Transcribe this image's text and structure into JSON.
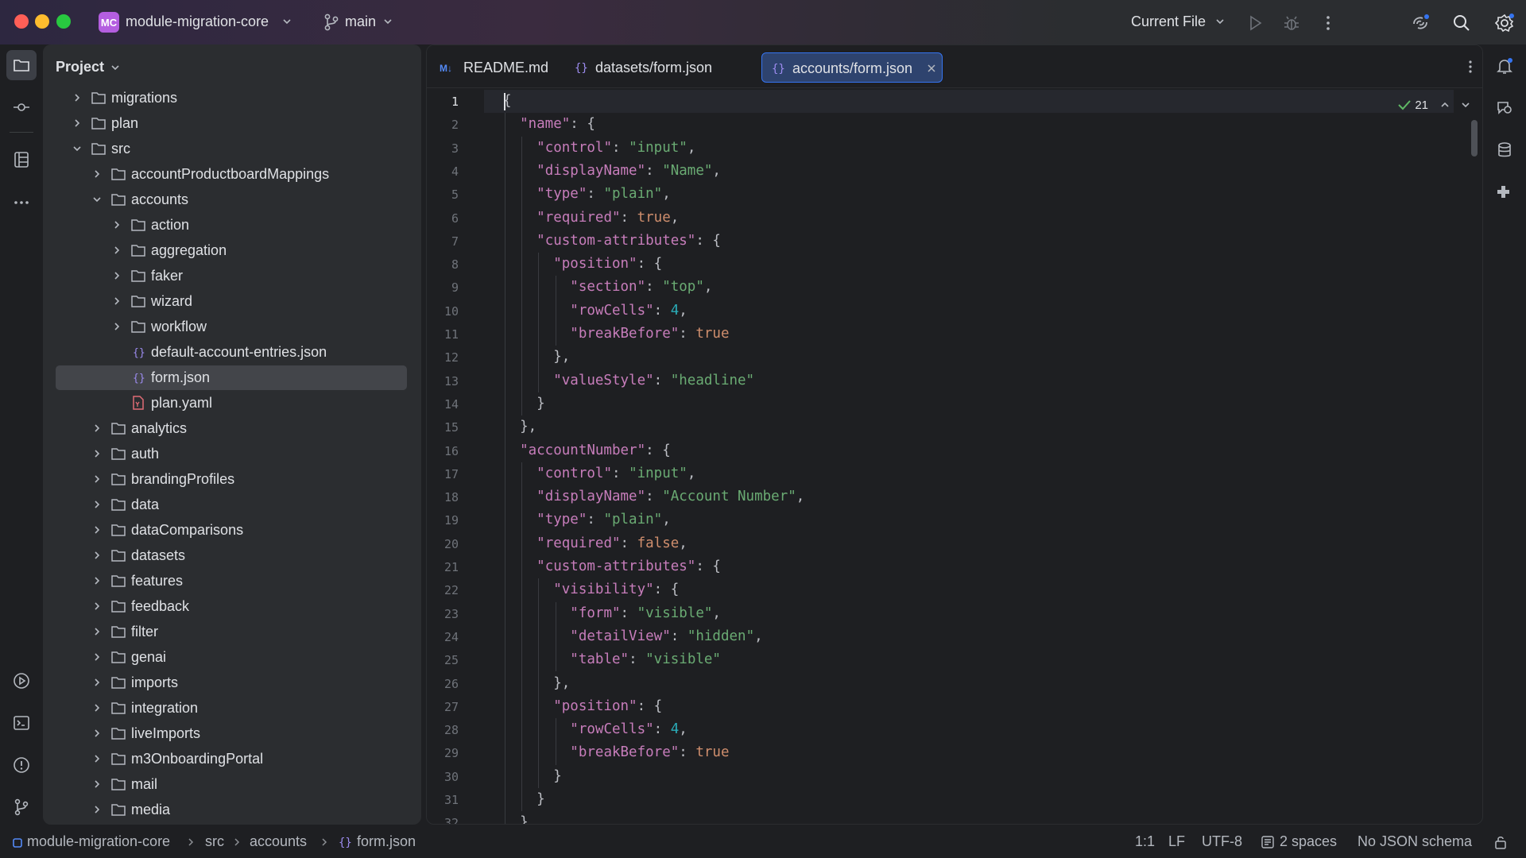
{
  "window": {
    "project_badge": "MC",
    "project_name": "module-migration-core",
    "branch": "main",
    "run_config": "Current File"
  },
  "project_panel": {
    "title": "Project",
    "items": [
      {
        "label": "migrations",
        "depth": 1,
        "type": "folder",
        "expanded": false
      },
      {
        "label": "plan",
        "depth": 1,
        "type": "folder",
        "expanded": false
      },
      {
        "label": "src",
        "depth": 1,
        "type": "folder",
        "expanded": true
      },
      {
        "label": "accountProductboardMappings",
        "depth": 2,
        "type": "folder",
        "expanded": false
      },
      {
        "label": "accounts",
        "depth": 2,
        "type": "folder",
        "expanded": true
      },
      {
        "label": "action",
        "depth": 3,
        "type": "folder",
        "expanded": false
      },
      {
        "label": "aggregation",
        "depth": 3,
        "type": "folder",
        "expanded": false
      },
      {
        "label": "faker",
        "depth": 3,
        "type": "folder",
        "expanded": false
      },
      {
        "label": "wizard",
        "depth": 3,
        "type": "folder",
        "expanded": false
      },
      {
        "label": "workflow",
        "depth": 3,
        "type": "folder",
        "expanded": false
      },
      {
        "label": "default-account-entries.json",
        "depth": 3,
        "type": "json"
      },
      {
        "label": "form.json",
        "depth": 3,
        "type": "json",
        "selected": true
      },
      {
        "label": "plan.yaml",
        "depth": 3,
        "type": "yaml"
      },
      {
        "label": "analytics",
        "depth": 2,
        "type": "folder",
        "expanded": false
      },
      {
        "label": "auth",
        "depth": 2,
        "type": "folder",
        "expanded": false
      },
      {
        "label": "brandingProfiles",
        "depth": 2,
        "type": "folder",
        "expanded": false
      },
      {
        "label": "data",
        "depth": 2,
        "type": "folder",
        "expanded": false
      },
      {
        "label": "dataComparisons",
        "depth": 2,
        "type": "folder",
        "expanded": false
      },
      {
        "label": "datasets",
        "depth": 2,
        "type": "folder",
        "expanded": false
      },
      {
        "label": "features",
        "depth": 2,
        "type": "folder",
        "expanded": false
      },
      {
        "label": "feedback",
        "depth": 2,
        "type": "folder",
        "expanded": false
      },
      {
        "label": "filter",
        "depth": 2,
        "type": "folder",
        "expanded": false
      },
      {
        "label": "genai",
        "depth": 2,
        "type": "folder",
        "expanded": false
      },
      {
        "label": "imports",
        "depth": 2,
        "type": "folder",
        "expanded": false
      },
      {
        "label": "integration",
        "depth": 2,
        "type": "folder",
        "expanded": false
      },
      {
        "label": "liveImports",
        "depth": 2,
        "type": "folder",
        "expanded": false
      },
      {
        "label": "m3OnboardingPortal",
        "depth": 2,
        "type": "folder",
        "expanded": false
      },
      {
        "label": "mail",
        "depth": 2,
        "type": "folder",
        "expanded": false
      },
      {
        "label": "media",
        "depth": 2,
        "type": "folder",
        "expanded": false
      }
    ]
  },
  "tabs": [
    {
      "label": "README.md",
      "icon": "markdown-icon",
      "active": false
    },
    {
      "label": "datasets/form.json",
      "icon": "json-icon",
      "active": false
    },
    {
      "label": "accounts/form.json",
      "icon": "json-icon",
      "active": true
    }
  ],
  "inspection": {
    "count": "21"
  },
  "code_lines": [
    [
      [
        "p",
        "{"
      ]
    ],
    [
      [
        "p",
        "  "
      ],
      [
        "k",
        "\"name\""
      ],
      [
        "p",
        ": {"
      ]
    ],
    [
      [
        "p",
        "    "
      ],
      [
        "k",
        "\"control\""
      ],
      [
        "p",
        ": "
      ],
      [
        "s",
        "\"input\""
      ],
      [
        "p",
        ","
      ]
    ],
    [
      [
        "p",
        "    "
      ],
      [
        "k",
        "\"displayName\""
      ],
      [
        "p",
        ": "
      ],
      [
        "s",
        "\"Name\""
      ],
      [
        "p",
        ","
      ]
    ],
    [
      [
        "p",
        "    "
      ],
      [
        "k",
        "\"type\""
      ],
      [
        "p",
        ": "
      ],
      [
        "s",
        "\"plain\""
      ],
      [
        "p",
        ","
      ]
    ],
    [
      [
        "p",
        "    "
      ],
      [
        "k",
        "\"required\""
      ],
      [
        "p",
        ": "
      ],
      [
        "b",
        "true"
      ],
      [
        "p",
        ","
      ]
    ],
    [
      [
        "p",
        "    "
      ],
      [
        "k",
        "\"custom-attributes\""
      ],
      [
        "p",
        ": {"
      ]
    ],
    [
      [
        "p",
        "      "
      ],
      [
        "k",
        "\"position\""
      ],
      [
        "p",
        ": {"
      ]
    ],
    [
      [
        "p",
        "        "
      ],
      [
        "k",
        "\"section\""
      ],
      [
        "p",
        ": "
      ],
      [
        "s",
        "\"top\""
      ],
      [
        "p",
        ","
      ]
    ],
    [
      [
        "p",
        "        "
      ],
      [
        "k",
        "\"rowCells\""
      ],
      [
        "p",
        ": "
      ],
      [
        "n",
        "4"
      ],
      [
        "p",
        ","
      ]
    ],
    [
      [
        "p",
        "        "
      ],
      [
        "k",
        "\"breakBefore\""
      ],
      [
        "p",
        ": "
      ],
      [
        "b",
        "true"
      ]
    ],
    [
      [
        "p",
        "      },"
      ]
    ],
    [
      [
        "p",
        "      "
      ],
      [
        "k",
        "\"valueStyle\""
      ],
      [
        "p",
        ": "
      ],
      [
        "s",
        "\"headline\""
      ]
    ],
    [
      [
        "p",
        "    }"
      ]
    ],
    [
      [
        "p",
        "  },"
      ]
    ],
    [
      [
        "p",
        "  "
      ],
      [
        "k",
        "\"accountNumber\""
      ],
      [
        "p",
        ": {"
      ]
    ],
    [
      [
        "p",
        "    "
      ],
      [
        "k",
        "\"control\""
      ],
      [
        "p",
        ": "
      ],
      [
        "s",
        "\"input\""
      ],
      [
        "p",
        ","
      ]
    ],
    [
      [
        "p",
        "    "
      ],
      [
        "k",
        "\"displayName\""
      ],
      [
        "p",
        ": "
      ],
      [
        "s",
        "\"Account Number\""
      ],
      [
        "p",
        ","
      ]
    ],
    [
      [
        "p",
        "    "
      ],
      [
        "k",
        "\"type\""
      ],
      [
        "p",
        ": "
      ],
      [
        "s",
        "\"plain\""
      ],
      [
        "p",
        ","
      ]
    ],
    [
      [
        "p",
        "    "
      ],
      [
        "k",
        "\"required\""
      ],
      [
        "p",
        ": "
      ],
      [
        "b",
        "false"
      ],
      [
        "p",
        ","
      ]
    ],
    [
      [
        "p",
        "    "
      ],
      [
        "k",
        "\"custom-attributes\""
      ],
      [
        "p",
        ": {"
      ]
    ],
    [
      [
        "p",
        "      "
      ],
      [
        "k",
        "\"visibility\""
      ],
      [
        "p",
        ": {"
      ]
    ],
    [
      [
        "p",
        "        "
      ],
      [
        "k",
        "\"form\""
      ],
      [
        "p",
        ": "
      ],
      [
        "s",
        "\"visible\""
      ],
      [
        "p",
        ","
      ]
    ],
    [
      [
        "p",
        "        "
      ],
      [
        "k",
        "\"detailView\""
      ],
      [
        "p",
        ": "
      ],
      [
        "s",
        "\"hidden\""
      ],
      [
        "p",
        ","
      ]
    ],
    [
      [
        "p",
        "        "
      ],
      [
        "k",
        "\"table\""
      ],
      [
        "p",
        ": "
      ],
      [
        "s",
        "\"visible\""
      ]
    ],
    [
      [
        "p",
        "      },"
      ]
    ],
    [
      [
        "p",
        "      "
      ],
      [
        "k",
        "\"position\""
      ],
      [
        "p",
        ": {"
      ]
    ],
    [
      [
        "p",
        "        "
      ],
      [
        "k",
        "\"rowCells\""
      ],
      [
        "p",
        ": "
      ],
      [
        "n",
        "4"
      ],
      [
        "p",
        ","
      ]
    ],
    [
      [
        "p",
        "        "
      ],
      [
        "k",
        "\"breakBefore\""
      ],
      [
        "p",
        ": "
      ],
      [
        "b",
        "true"
      ]
    ],
    [
      [
        "p",
        "      }"
      ]
    ],
    [
      [
        "p",
        "    }"
      ]
    ],
    [
      [
        "p",
        "  },"
      ]
    ]
  ],
  "statusbar": {
    "breadcrumb": [
      "module-migration-core",
      "src",
      "accounts",
      "form.json"
    ],
    "position": "1:1",
    "line_ending": "LF",
    "encoding": "UTF-8",
    "indent": "2 spaces",
    "schema": "No JSON schema"
  },
  "colors": {
    "key": "#c77dbb",
    "string": "#6aab73",
    "number": "#2aacb8",
    "boolean": "#cf8e6d",
    "accent": "#3574f0",
    "badge": "#b45ee0"
  }
}
